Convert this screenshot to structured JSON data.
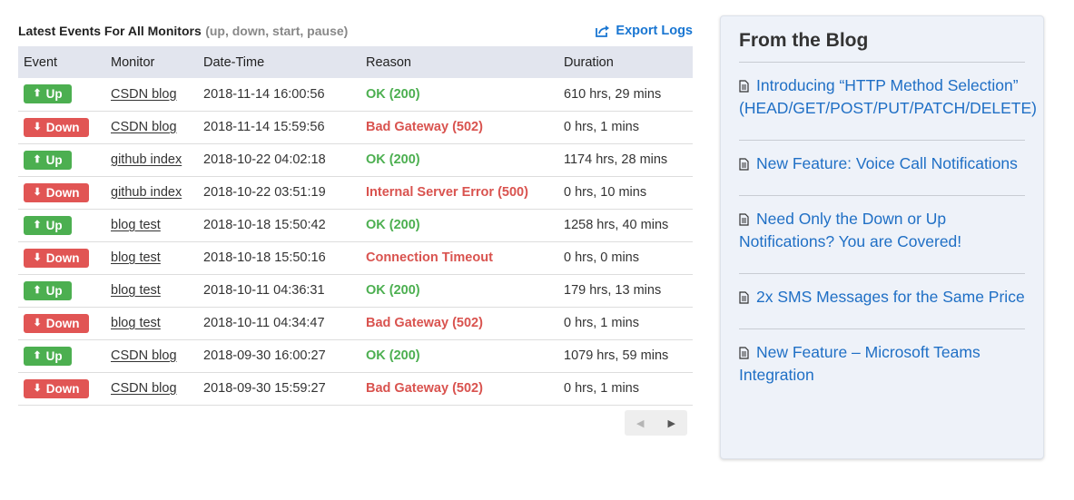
{
  "events": {
    "title": "Latest Events For All Monitors",
    "subtitle": "(up, down, start, pause)",
    "export_label": "Export Logs",
    "columns": [
      "Event",
      "Monitor",
      "Date-Time",
      "Reason",
      "Duration"
    ],
    "rows": [
      {
        "event": "Up",
        "status": "up",
        "monitor": "CSDN blog",
        "datetime": "2018-11-14 16:00:56",
        "reason": "OK (200)",
        "duration": "610 hrs, 29 mins"
      },
      {
        "event": "Down",
        "status": "down",
        "monitor": "CSDN blog",
        "datetime": "2018-11-14 15:59:56",
        "reason": "Bad Gateway (502)",
        "duration": "0 hrs, 1 mins"
      },
      {
        "event": "Up",
        "status": "up",
        "monitor": "github index",
        "datetime": "2018-10-22 04:02:18",
        "reason": "OK (200)",
        "duration": "1174 hrs, 28 mins"
      },
      {
        "event": "Down",
        "status": "down",
        "monitor": "github index",
        "datetime": "2018-10-22 03:51:19",
        "reason": "Internal Server Error (500)",
        "duration": "0 hrs, 10 mins"
      },
      {
        "event": "Up",
        "status": "up",
        "monitor": "blog test",
        "datetime": "2018-10-18 15:50:42",
        "reason": "OK (200)",
        "duration": "1258 hrs, 40 mins"
      },
      {
        "event": "Down",
        "status": "down",
        "monitor": "blog test",
        "datetime": "2018-10-18 15:50:16",
        "reason": "Connection Timeout",
        "duration": "0 hrs, 0 mins"
      },
      {
        "event": "Up",
        "status": "up",
        "monitor": "blog test",
        "datetime": "2018-10-11 04:36:31",
        "reason": "OK (200)",
        "duration": "179 hrs, 13 mins"
      },
      {
        "event": "Down",
        "status": "down",
        "monitor": "blog test",
        "datetime": "2018-10-11 04:34:47",
        "reason": "Bad Gateway (502)",
        "duration": "0 hrs, 1 mins"
      },
      {
        "event": "Up",
        "status": "up",
        "monitor": "CSDN blog",
        "datetime": "2018-09-30 16:00:27",
        "reason": "OK (200)",
        "duration": "1079 hrs, 59 mins"
      },
      {
        "event": "Down",
        "status": "down",
        "monitor": "CSDN blog",
        "datetime": "2018-09-30 15:59:27",
        "reason": "Bad Gateway (502)",
        "duration": "0 hrs, 1 mins"
      }
    ],
    "pager": {
      "prev_icon": "chevron-left-icon",
      "next_icon": "chevron-right-icon"
    }
  },
  "blog": {
    "title": "From the Blog",
    "posts": [
      "Introducing “HTTP Method Selection” (HEAD/GET/POST/PUT/PATCH/DELETE)",
      "New Feature: Voice Call Notifications",
      "Need Only the Down or Up Notifications? You are Covered!",
      "2x SMS Messages for the Same Price",
      "New Feature – Microsoft Teams Integration"
    ]
  },
  "colors": {
    "up": "#4caf50",
    "down": "#e15554",
    "link": "#1f6fc5",
    "header_bg": "#e2e5ee",
    "panel_bg": "#eef2f9"
  }
}
